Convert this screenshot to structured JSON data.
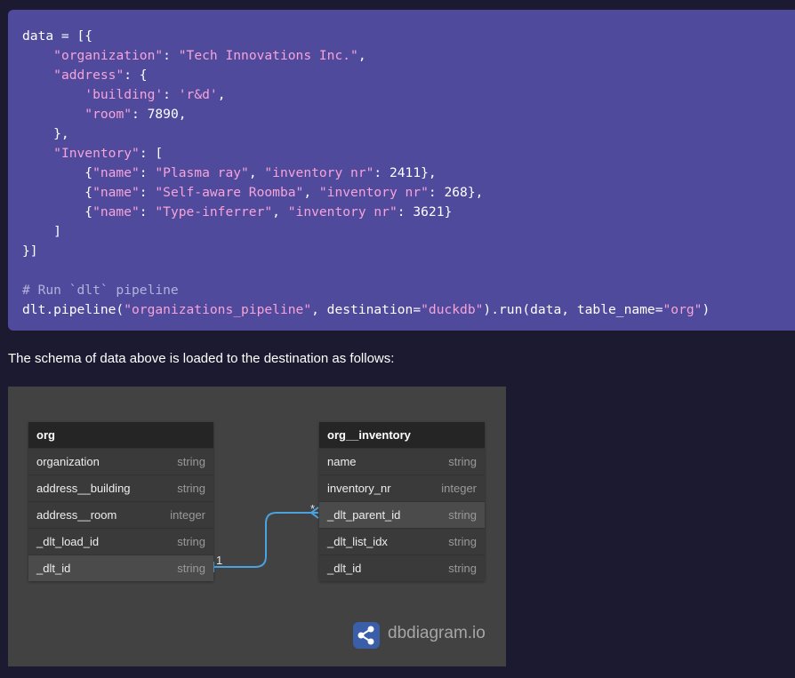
{
  "code": {
    "l1": "data = [{",
    "k_org": "\"organization\"",
    "v_org": "\"Tech Innovations Inc.\"",
    "k_addr": "\"address\"",
    "k_bld": "'building'",
    "v_bld": "'r&d'",
    "k_room": "\"room\"",
    "v_room": "7890",
    "k_inv": "\"Inventory\"",
    "items": [
      {
        "k_name": "\"name\"",
        "v_name": "\"Plasma ray\"",
        "k_nr": "\"inventory nr\"",
        "v_nr": "2411",
        "end": "},"
      },
      {
        "k_name": "\"name\"",
        "v_name": "\"Self-aware Roomba\"",
        "k_nr": "\"inventory nr\"",
        "v_nr": "268",
        "end": "},"
      },
      {
        "k_name": "\"name\"",
        "v_name": "\"Type-inferrer\"",
        "k_nr": "\"inventory nr\"",
        "v_nr": "3621",
        "end": "}"
      }
    ],
    "comment": "# Run `dlt` pipeline",
    "run_prefix": "dlt.pipeline(",
    "run_pipeline_name": "\"organizations_pipeline\"",
    "run_dest_kw": ", destination=",
    "run_dest": "\"duckdb\"",
    "run_mid": ").run(data, table_name=",
    "run_table": "\"org\"",
    "run_end": ")"
  },
  "caption": "The schema of data above is loaded to the destination as follows:",
  "diagram": {
    "tables": [
      {
        "name": "org",
        "columns": [
          {
            "name": "organization",
            "type": "string"
          },
          {
            "name": "address__building",
            "type": "string"
          },
          {
            "name": "address__room",
            "type": "integer"
          },
          {
            "name": "_dlt_load_id",
            "type": "string"
          },
          {
            "name": "_dlt_id",
            "type": "string"
          }
        ]
      },
      {
        "name": "org__inventory",
        "columns": [
          {
            "name": "name",
            "type": "string"
          },
          {
            "name": "inventory_nr",
            "type": "integer"
          },
          {
            "name": "_dlt_parent_id",
            "type": "string"
          },
          {
            "name": "_dlt_list_idx",
            "type": "string"
          },
          {
            "name": "_dlt_id",
            "type": "string"
          }
        ]
      }
    ],
    "relationship": {
      "from_cardinality": "1",
      "to_cardinality": "*",
      "color": "#4aa3df"
    },
    "brand": "dbdiagram.io",
    "brand_icon": "share-nodes-icon"
  },
  "colors": {
    "page_bg": "#1b1a30",
    "code_bg": "#4f4a9c",
    "string_literal": "#f7a3d8",
    "comment": "#b6b1dc",
    "diagram_bg": "#424242",
    "table_header_bg": "#252525",
    "brand_logo": "#3a5ea8"
  }
}
